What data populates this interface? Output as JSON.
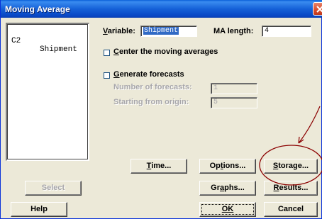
{
  "window": {
    "title": "Moving Average"
  },
  "columns_list": {
    "items": [
      {
        "col": "C2",
        "name": "Shipment"
      }
    ]
  },
  "fields": {
    "variable_label": "Variable:",
    "variable_value": "Shipment",
    "ma_length_label": "MA length:",
    "ma_length_value": "4",
    "number_of_forecasts_label": "Number of forecasts:",
    "number_of_forecasts_value": "1",
    "starting_origin_label": "Starting from origin:",
    "starting_origin_value": "5"
  },
  "options": {
    "center_label": "Center the moving averages",
    "center_checked": false,
    "forecasts_label": "Generate forecasts",
    "forecasts_checked": false
  },
  "buttons": {
    "time": "Time...",
    "options": "Options...",
    "storage": "Storage...",
    "select": "Select",
    "graphs": "Graphs...",
    "results": "Results...",
    "help": "Help",
    "ok": "OK",
    "cancel": "Cancel"
  },
  "colors": {
    "annotation": "#8b0000",
    "title_bar": "#0a5fd8",
    "selection": "#316ac5"
  }
}
